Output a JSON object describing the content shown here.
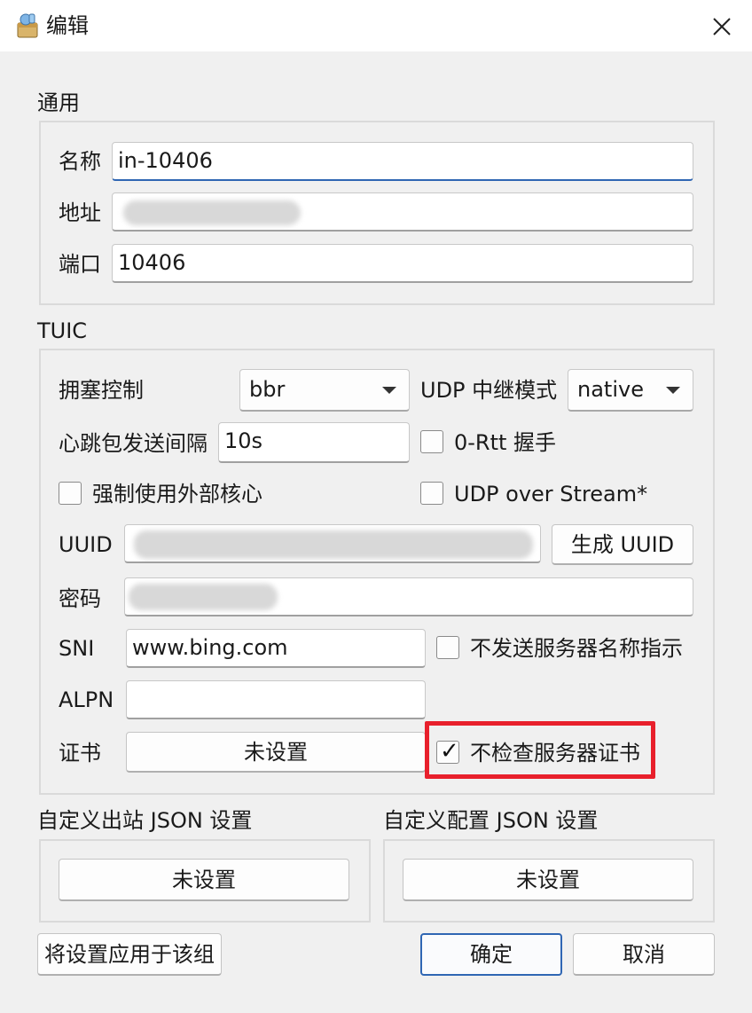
{
  "window": {
    "title": "编辑",
    "close_icon": "close-icon"
  },
  "general": {
    "section_label": "通用",
    "name_label": "名称",
    "name_value": "in-10406",
    "address_label": "地址",
    "address_value": "",
    "port_label": "端口",
    "port_value": "10406"
  },
  "tuic": {
    "section_label": "TUIC",
    "congestion_label": "拥塞控制",
    "congestion_value": "bbr",
    "udp_relay_label": "UDP 中继模式",
    "udp_relay_value": "native",
    "heartbeat_label": "心跳包发送间隔",
    "heartbeat_value": "10s",
    "zero_rtt_label": "0-Rtt 握手",
    "zero_rtt_checked": false,
    "force_external_label": "强制使用外部核心",
    "force_external_checked": false,
    "udp_over_stream_label": "UDP over Stream*",
    "udp_over_stream_checked": false,
    "uuid_label": "UUID",
    "uuid_value": "",
    "generate_uuid_label": "生成 UUID",
    "password_label": "密码",
    "password_value": "",
    "sni_label": "SNI",
    "sni_value": "www.bing.com",
    "no_sni_label": "不发送服务器名称指示",
    "no_sni_checked": false,
    "alpn_label": "ALPN",
    "alpn_value": "",
    "cert_label": "证书",
    "cert_button_label": "未设置",
    "insecure_label": "不检查服务器证书",
    "insecure_checked": true,
    "check_mark": "✓"
  },
  "custom_outbound": {
    "section_label": "自定义出站 JSON 设置",
    "button_label": "未设置"
  },
  "custom_config": {
    "section_label": "自定义配置 JSON 设置",
    "button_label": "未设置"
  },
  "footer": {
    "apply_group_label": "将设置应用于该组",
    "ok_label": "确定",
    "cancel_label": "取消"
  },
  "colors": {
    "accent": "#2f66b3",
    "highlight": "#e8202c",
    "background": "#f0f0f0"
  }
}
